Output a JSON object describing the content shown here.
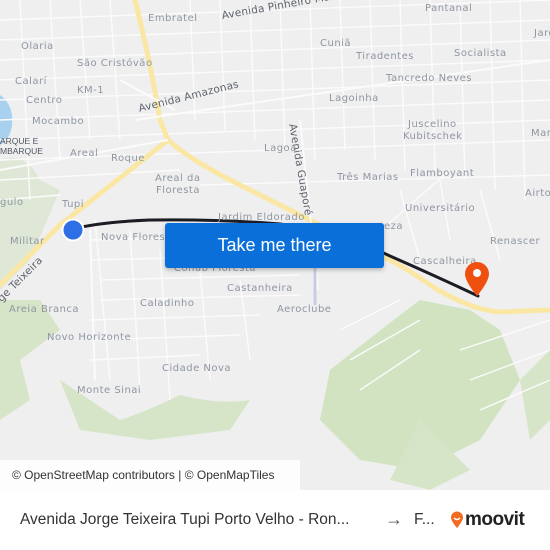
{
  "map": {
    "neighborhood_labels": [
      {
        "text": "Embratel"
      },
      {
        "text": "Pantanal"
      },
      {
        "text": "Olaria"
      },
      {
        "text": "São Cristóvão"
      },
      {
        "text": "Cuniã"
      },
      {
        "text": "Tiradentes"
      },
      {
        "text": "Socialista"
      },
      {
        "text": "Jard"
      },
      {
        "text": "Calarí"
      },
      {
        "text": "KM-1"
      },
      {
        "text": "Tancredo Neves"
      },
      {
        "text": "Centro"
      },
      {
        "text": "Lagoinha"
      },
      {
        "text": "Mocambo"
      },
      {
        "text": "Juscelino"
      },
      {
        "text": "Kubitschek"
      },
      {
        "text": "Mar"
      },
      {
        "text": "Areal"
      },
      {
        "text": "Roque"
      },
      {
        "text": "Lagoa"
      },
      {
        "text": "Três Marias"
      },
      {
        "text": "Flamboyant"
      },
      {
        "text": "Areal da"
      },
      {
        "text": "Floresta"
      },
      {
        "text": "Airto"
      },
      {
        "text": "gulo"
      },
      {
        "text": "Tupi"
      },
      {
        "text": "Universitário"
      },
      {
        "text": "Jardim Eldorado"
      },
      {
        "text": "Militar"
      },
      {
        "text": "Nova Flores"
      },
      {
        "text": "eza"
      },
      {
        "text": "Renascer"
      },
      {
        "text": "Cascalheira"
      },
      {
        "text": "Cohab Floresta"
      },
      {
        "text": "Castanheira"
      },
      {
        "text": "Areia Branca"
      },
      {
        "text": "Caladinho"
      },
      {
        "text": "Aeroclube"
      },
      {
        "text": "Novo Horizonte"
      },
      {
        "text": "Cidade Nova"
      },
      {
        "text": "Monte Sinai"
      }
    ],
    "road_labels": [
      {
        "text": "Avenida Pinheiro Machado"
      },
      {
        "text": "Avenida Amazonas"
      },
      {
        "text": "Avenida Guaporé"
      },
      {
        "text": "ge Teixeira"
      }
    ],
    "poi_labels": [
      {
        "text": "ARQUE E"
      },
      {
        "text": "MBARQUE"
      }
    ],
    "origin_marker_color": "#2f6fe6",
    "destination_marker_color": "#f0500f",
    "route_color": "#1c1c24",
    "attribution": "© OpenStreetMap contributors | © OpenMapTiles"
  },
  "cta": {
    "label": "Take me there",
    "color": "#0a6fd8"
  },
  "footer": {
    "origin": "Avenida Jorge Teixeira Tupi Porto Velho - Ron...",
    "arrow": "→",
    "destination": "F...",
    "brand": "moovit",
    "brand_color": "#f26b21"
  }
}
